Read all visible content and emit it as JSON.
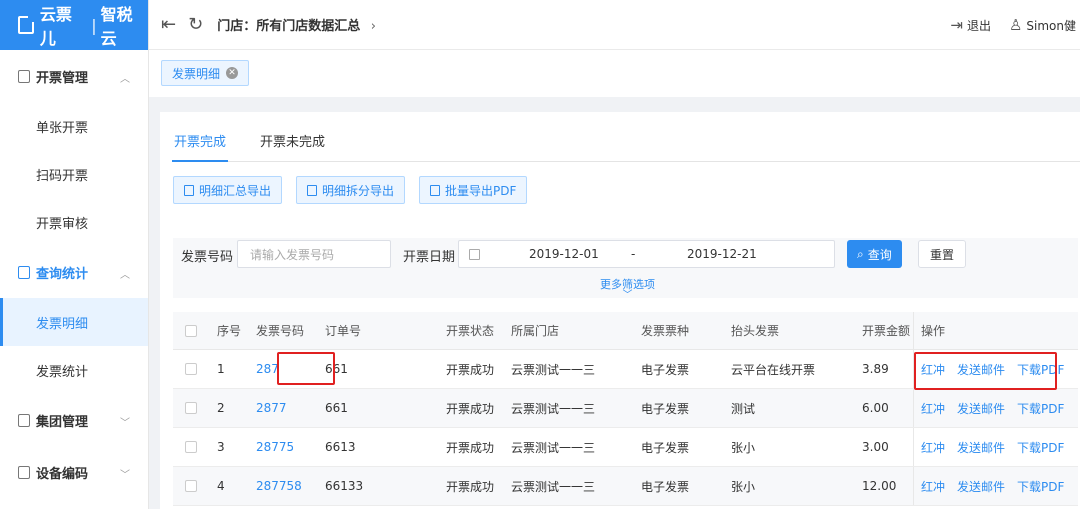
{
  "brand": {
    "name": "云票儿",
    "product": "智税云",
    "separator": "|"
  },
  "sidebar": {
    "groups": [
      {
        "label": "开票管理",
        "items": [
          "单张开票",
          "扫码开票",
          "开票审核"
        ]
      },
      {
        "label": "查询统计",
        "items": [
          "发票明细",
          "发票统计"
        ]
      },
      {
        "label": "集团管理",
        "items": []
      },
      {
        "label": "设备编码",
        "items": []
      }
    ],
    "active_item": "发票明细"
  },
  "header": {
    "breadcrumb": "门店：所有门店数据汇总",
    "logout_label": "退出",
    "user_name": "Simon健"
  },
  "tagbar": {
    "tag_label": "发票明细"
  },
  "tabs": [
    "开票完成",
    "开票未完成"
  ],
  "actions": {
    "export_summary": "明细汇总导出",
    "export_split": "明细拆分导出",
    "batch_pdf": "批量导出PDF"
  },
  "filters": {
    "invoice_no_label": "发票号码",
    "invoice_no_placeholder": "请输入发票号码",
    "date_label": "开票日期",
    "date_start": "2019-12-01",
    "date_sep": "-",
    "date_end": "2019-12-21",
    "search_button": "查询",
    "reset_button": "重置",
    "more_options": "更多筛选项"
  },
  "table": {
    "columns": [
      "序号",
      "发票号码",
      "订单号",
      "开票状态",
      "所属门店",
      "发票票种",
      "抬头发票",
      "开票金额",
      "操作"
    ],
    "rows": [
      {
        "seq": "1",
        "invoice_no": "287",
        "order_no": "661",
        "status": "开票成功",
        "store": "云票测试一一三",
        "type": "电子发票",
        "title": "云平台在线开票",
        "amount": "3.89"
      },
      {
        "seq": "2",
        "invoice_no": "2877",
        "order_no": "661",
        "status": "开票成功",
        "store": "云票测试一一三",
        "type": "电子发票",
        "title": "测试",
        "amount": "6.00"
      },
      {
        "seq": "3",
        "invoice_no": "28775",
        "order_no": "6613",
        "status": "开票成功",
        "store": "云票测试一一三",
        "type": "电子发票",
        "title": "张小",
        "amount": "3.00"
      },
      {
        "seq": "4",
        "invoice_no": "287758",
        "order_no": "66133",
        "status": "开票成功",
        "store": "云票测试一一三",
        "type": "电子发票",
        "title": "张小",
        "amount": "12.00"
      }
    ],
    "row_actions": [
      "红冲",
      "发送邮件",
      "下载PDF"
    ]
  },
  "colors": {
    "primary": "#2d8cf0",
    "highlight": "#e02020"
  }
}
